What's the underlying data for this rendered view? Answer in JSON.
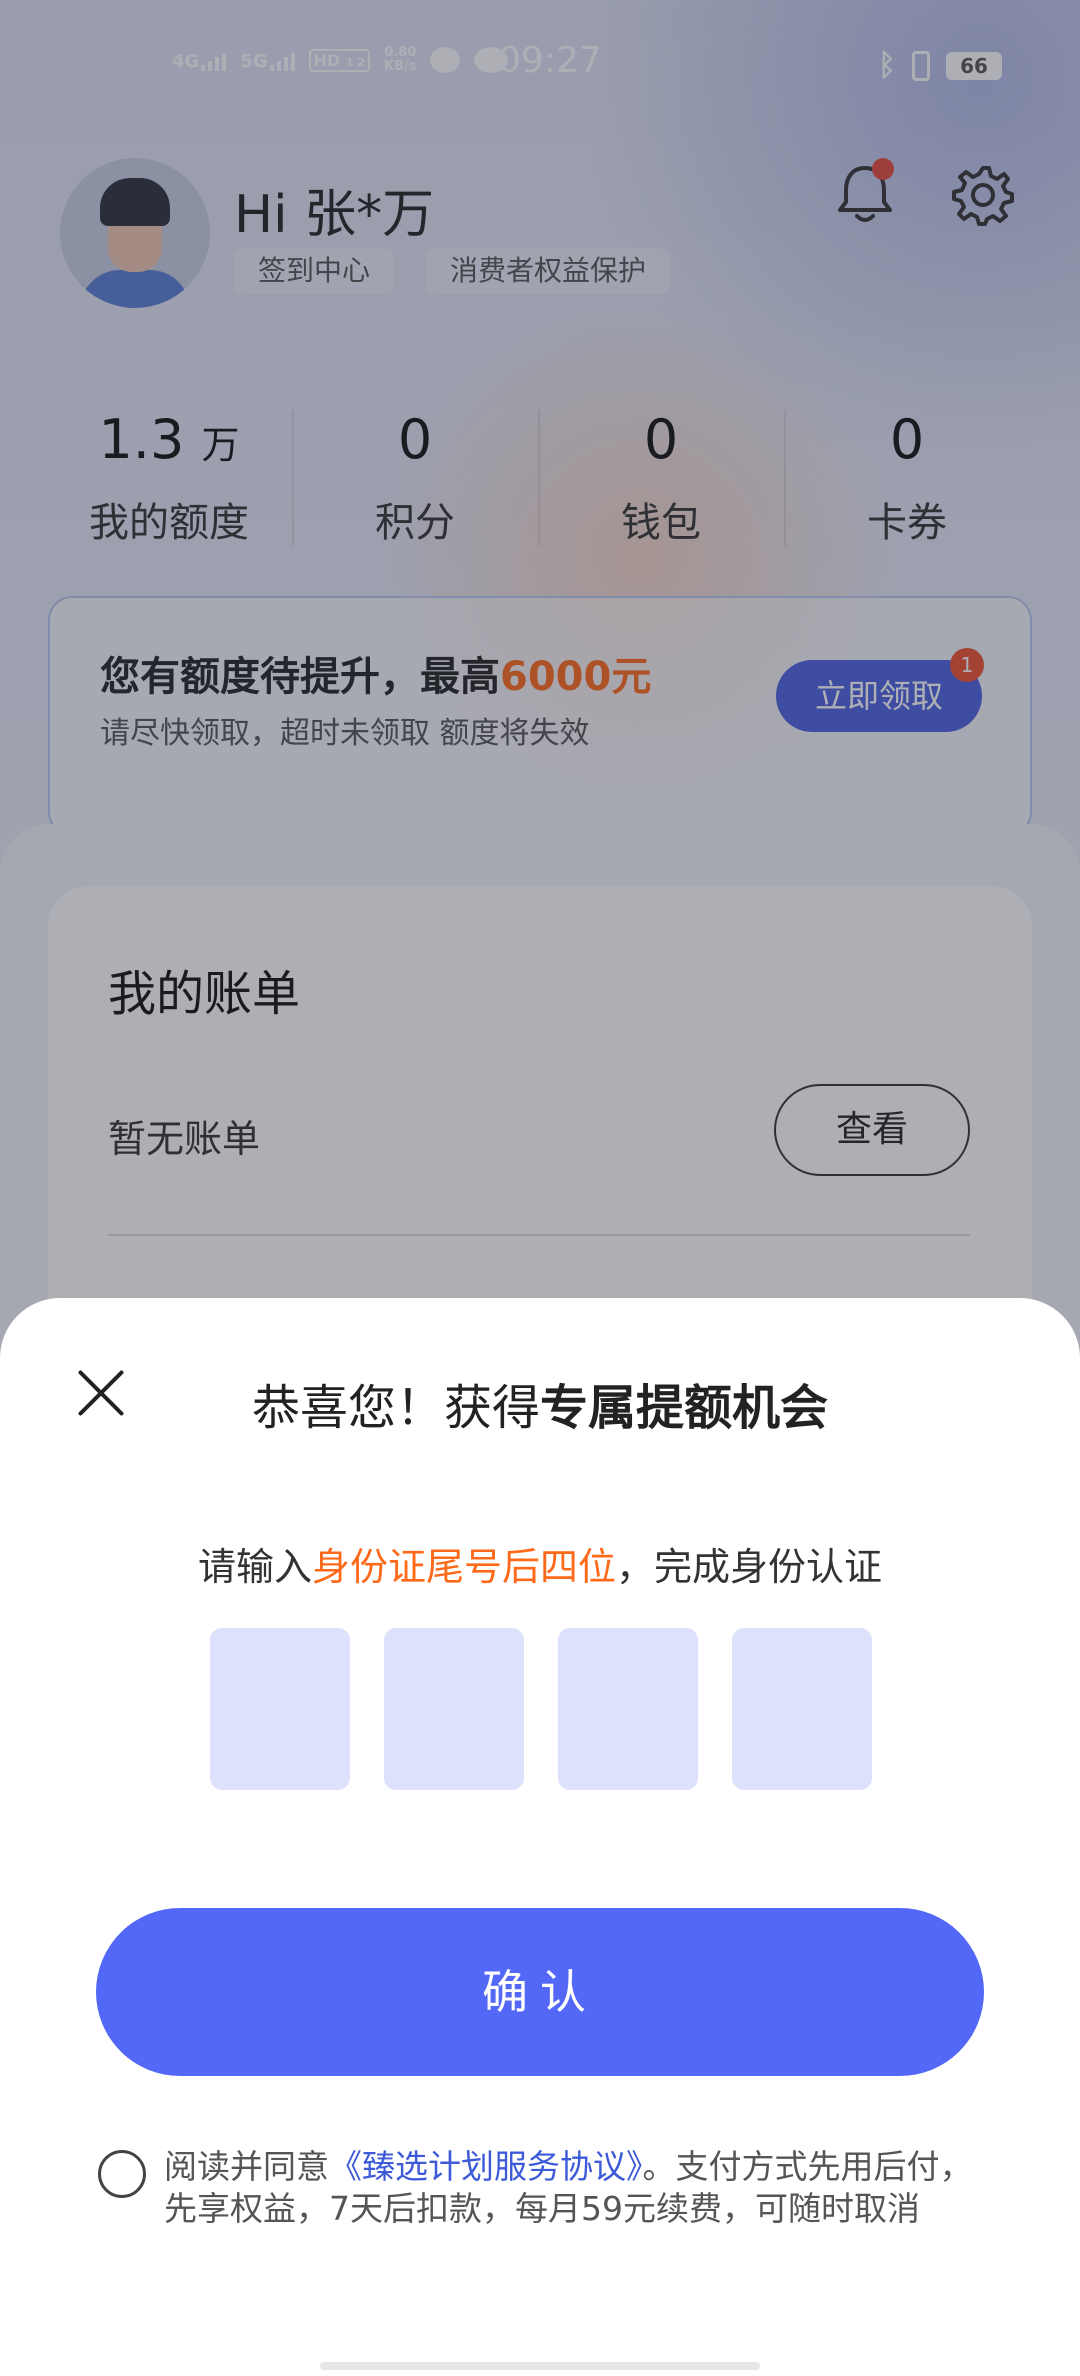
{
  "status_bar": {
    "signal_1": "4G",
    "signal_2": "5G",
    "hd": "HD",
    "hd_sub": "1 2",
    "net_speed": "0.80",
    "net_unit": "KB/s",
    "time": "09:27",
    "battery": "66"
  },
  "header": {
    "greeting": "Hi 张*万",
    "chips": [
      "签到中心",
      "消费者权益保护"
    ]
  },
  "stats": [
    {
      "value": "1.3",
      "unit": "万",
      "label": "我的额度"
    },
    {
      "value": "0",
      "unit": "",
      "label": "积分"
    },
    {
      "value": "0",
      "unit": "",
      "label": "钱包"
    },
    {
      "value": "0",
      "unit": "",
      "label": "卡券"
    }
  ],
  "promo": {
    "title": "您有额度待提升，最高",
    "highlight": "6000元",
    "subtitle": "请尽快领取，超时未领取 额度将失效",
    "button": "立即领取",
    "badge": "1"
  },
  "bill": {
    "title": "我的账单",
    "empty": "暂无账单",
    "view_button": "查看"
  },
  "sheet": {
    "title_regular": "恭喜您！获得",
    "title_bold": "专属提额机会",
    "prompt_pre": "请输入",
    "prompt_highlight": "身份证尾号后四位",
    "prompt_post": "，完成身份认证",
    "confirm": "确认",
    "agree_pre": "阅读并同意",
    "agree_link": "《臻选计划服务协议》",
    "agree_post": "。支付方式先用后付，先享权益，7天后扣款，每月59元续费，可随时取消"
  },
  "colors": {
    "accent": "#5468f7",
    "highlight": "#ff6a1a",
    "code_box": "#dde1fb",
    "link": "#3d5bd8"
  }
}
